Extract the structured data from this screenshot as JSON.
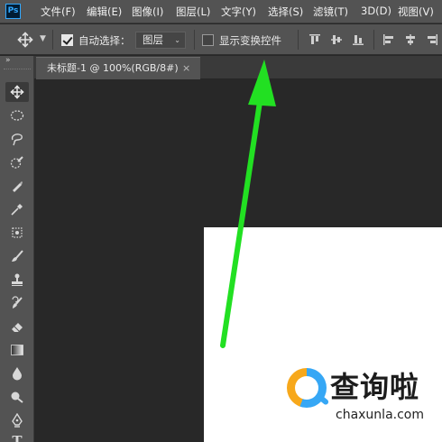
{
  "app": {
    "logo_text": "Ps"
  },
  "menu": {
    "items": [
      {
        "label": "文件(F)"
      },
      {
        "label": "编辑(E)"
      },
      {
        "label": "图像(I)"
      },
      {
        "label": "图层(L)"
      },
      {
        "label": "文字(Y)"
      },
      {
        "label": "选择(S)"
      },
      {
        "label": "滤镜(T)"
      },
      {
        "label": "3D(D)"
      },
      {
        "label": "视图(V)"
      }
    ],
    "highlight_color": "#d41d1d"
  },
  "options_bar": {
    "auto_select": {
      "label": "自动选择：",
      "checked": true
    },
    "auto_select_target": {
      "value": "图层"
    },
    "show_transform_controls": {
      "label": "显示变换控件",
      "checked": false
    }
  },
  "document_tab": {
    "title": "未标题-1 @ 100%(RGB/8#)",
    "close_glyph": "×"
  },
  "toolbar": {
    "collapse_glyph": "»",
    "type_tool_glyph": "T"
  },
  "annotation": {
    "arrow_color": "#22e022"
  },
  "watermark": {
    "title": "查询啦",
    "url": "chaxunla.com",
    "colors": {
      "blue": "#36a7f5",
      "orange": "#f7a81b"
    }
  },
  "colors": {
    "panel": "#535353",
    "workspace": "#282828",
    "canvas": "#ffffff"
  }
}
